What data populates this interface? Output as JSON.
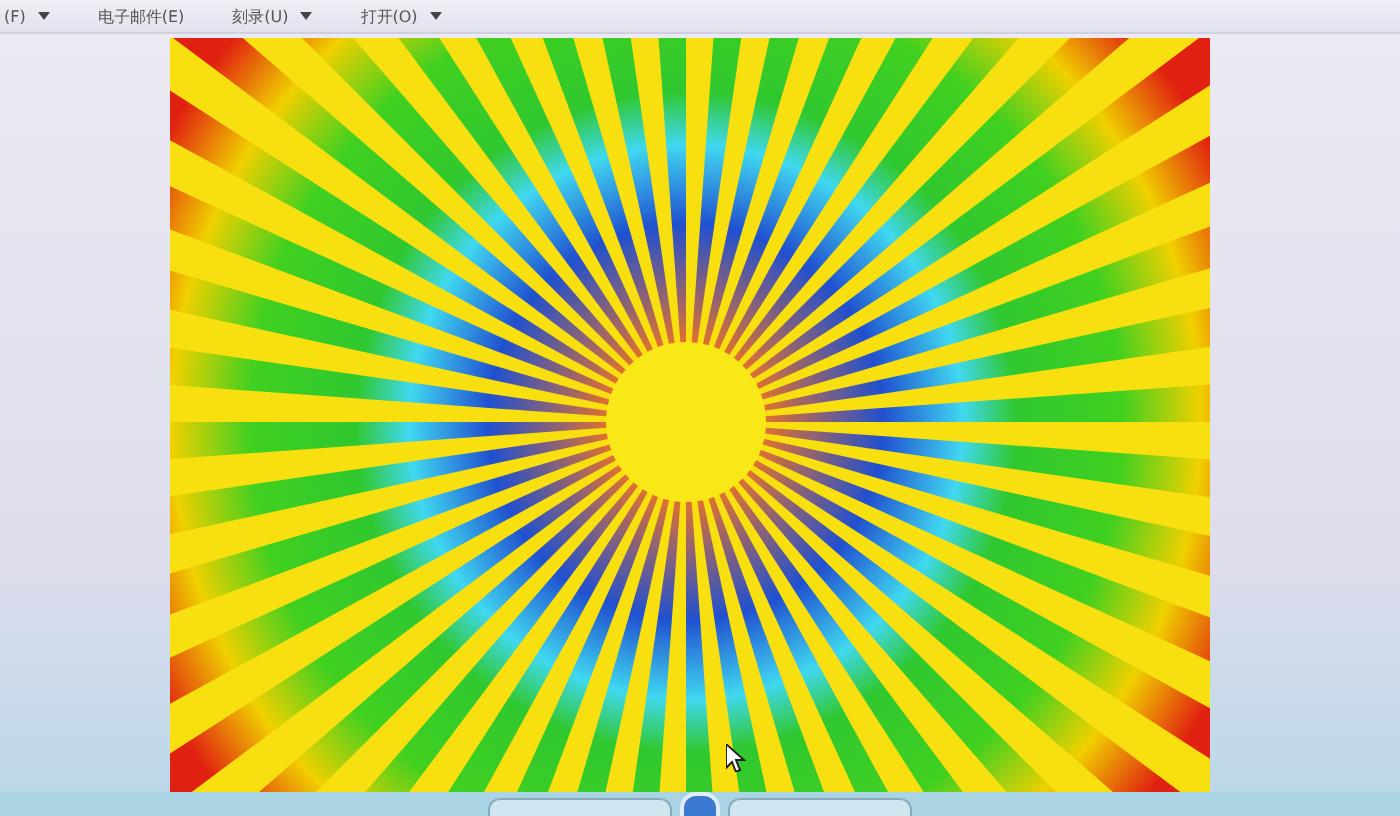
{
  "toolbar": {
    "items": [
      {
        "label": "(F)",
        "has_dropdown": true
      },
      {
        "label": "电子邮件(E)",
        "has_dropdown": false
      },
      {
        "label": "刻录(U)",
        "has_dropdown": true
      },
      {
        "label": "打开(O)",
        "has_dropdown": true
      }
    ]
  }
}
